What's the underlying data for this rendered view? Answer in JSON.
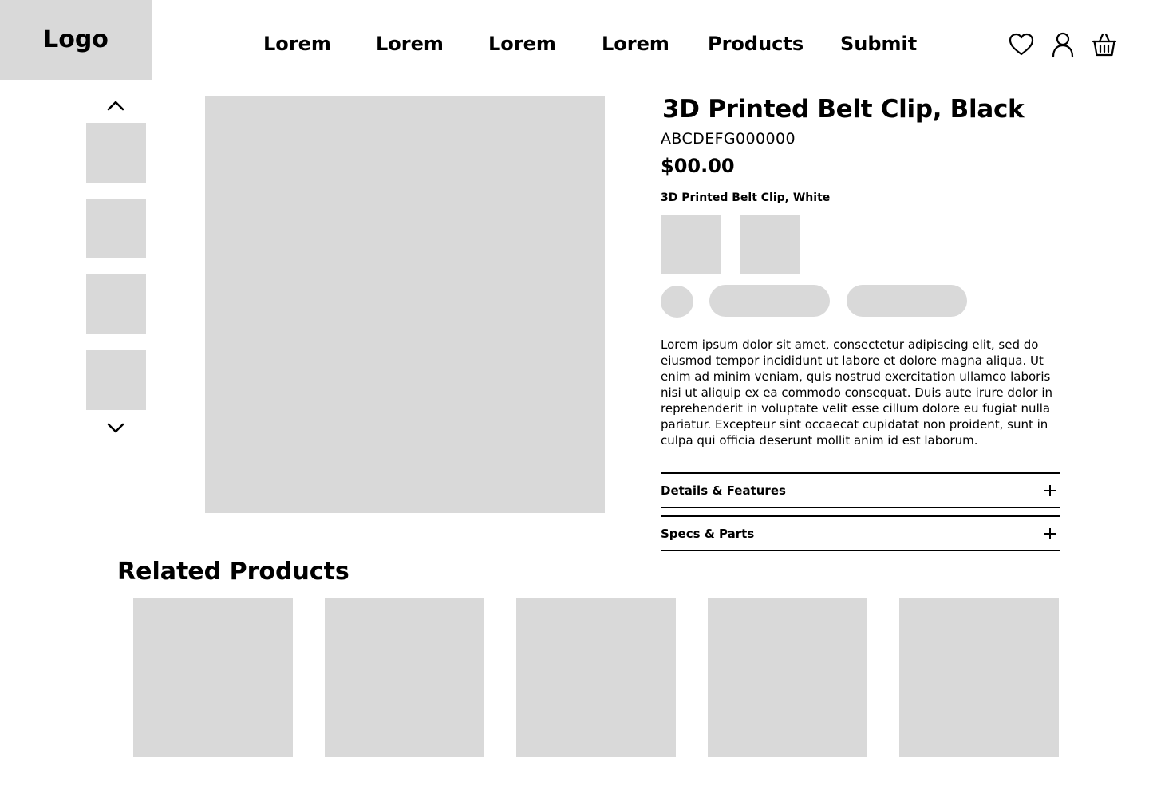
{
  "header": {
    "logo": "Logo",
    "nav": [
      {
        "label": "Lorem"
      },
      {
        "label": "Lorem"
      },
      {
        "label": "Lorem"
      },
      {
        "label": "Lorem"
      },
      {
        "label": "Products"
      },
      {
        "label": "Submit"
      }
    ],
    "icons": [
      "heart-icon",
      "user-icon",
      "basket-icon"
    ]
  },
  "gallery": {
    "up_icon": "chevron-up-icon",
    "down_icon": "chevron-down-icon",
    "thumbnail_count": 4
  },
  "product": {
    "title": "3D Printed Belt Clip, Black",
    "sku": "ABCDEFG000000",
    "price": "$00.00",
    "variant_label": "3D Printed Belt Clip, White",
    "description": "Lorem ipsum dolor sit amet, consectetur adipiscing elit, sed do eiusmod tempor incididunt ut labore et dolore magna aliqua. Ut enim ad minim veniam, quis nostrud exercitation ullamco laboris nisi ut aliquip ex ea commodo consequat. Duis aute irure dolor in reprehenderit in voluptate velit esse cillum dolore eu fugiat nulla pariatur. Excepteur sint occaecat cupidatat non proident, sunt in culpa qui officia deserunt mollit anim id est laborum.",
    "accordions": [
      {
        "label": "Details & Features",
        "icon": "plus-icon"
      },
      {
        "label": "Specs & Parts",
        "icon": "plus-icon"
      }
    ]
  },
  "related": {
    "heading": "Related Products",
    "card_count": 5
  },
  "colors": {
    "placeholder": "#d9d9d9",
    "text": "#000000",
    "background": "#ffffff"
  }
}
